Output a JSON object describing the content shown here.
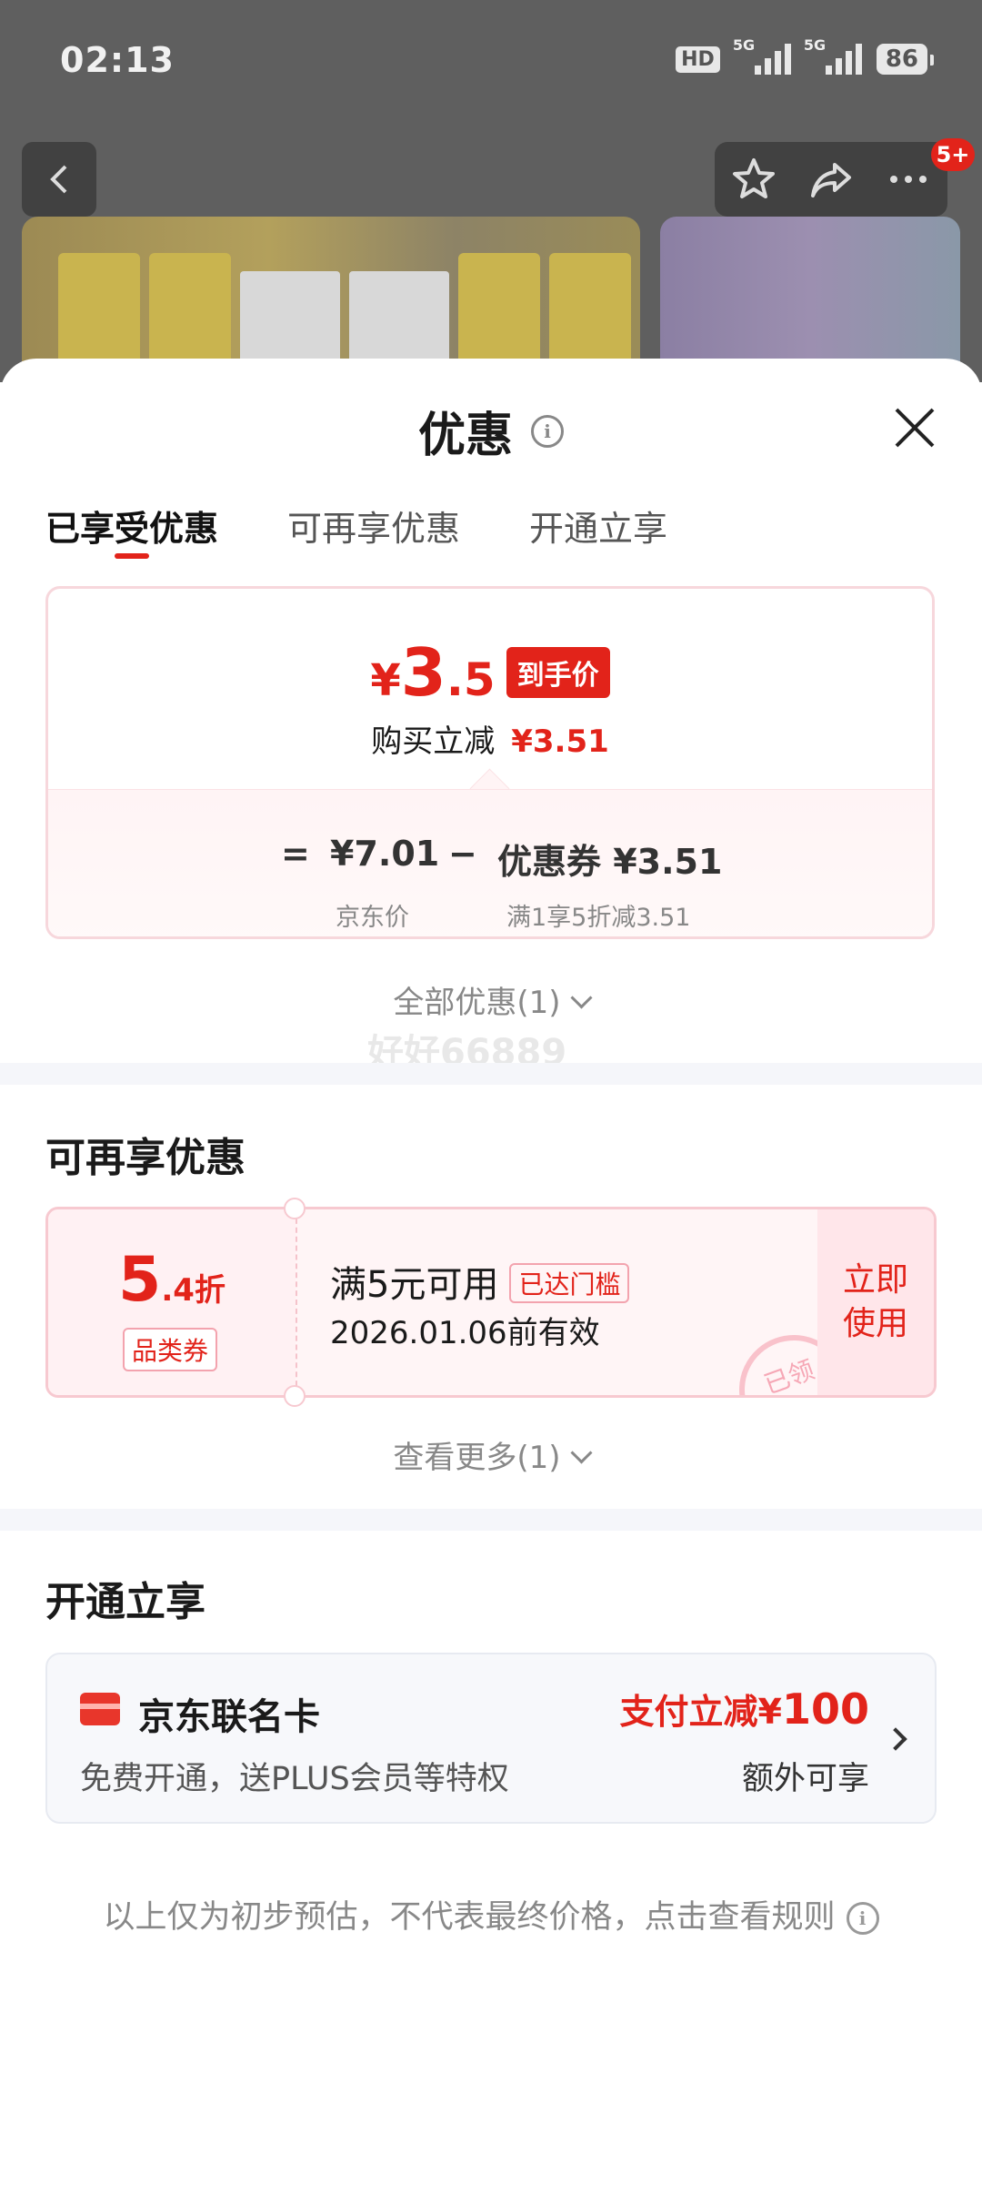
{
  "status_bar": {
    "time": "02:13",
    "hd_label": "HD",
    "signal1_label": "5G",
    "signal2_label": "5G",
    "battery": "86"
  },
  "background_page": {
    "message_badge": "5+"
  },
  "sheet": {
    "title": "优惠",
    "tabs": [
      "已享受优惠",
      "可再享优惠",
      "开通立享"
    ],
    "active_tab": "已享受优惠"
  },
  "price_card": {
    "currency": "¥",
    "price_int": "3",
    "price_dec": ".5",
    "price_tag": "到手价",
    "saving_label": "购买立减",
    "saving_value": "¥3.51",
    "equals": "=",
    "base_price": "¥7.01",
    "minus": "−",
    "coupon_part": "优惠券 ¥3.51",
    "base_price_label": "京东价",
    "coupon_part_label": "满1享5折减3.51"
  },
  "all_offers_link": "全部优惠(1)",
  "watermark": "好好66889",
  "more_offers": {
    "title": "可再享优惠",
    "coupon": {
      "value_big": "5",
      "value_small": ".4折",
      "type": "品类券",
      "condition": "满5元可用",
      "badge": "已达门槛",
      "validity": "2026.01.06前有效",
      "action_line1": "立即",
      "action_line2": "使用",
      "stamp": "已领"
    },
    "see_more_link": "查看更多(1)"
  },
  "open_offers": {
    "title": "开通立享",
    "card": {
      "name": "京东联名卡",
      "desc": "免费开通，送PLUS会员等特权",
      "promo_prefix": "支付立减¥",
      "promo_amount": "100",
      "extra": "额外可享"
    }
  },
  "disclaimer": "以上仅为初步预估，不代表最终价格，点击查看规则",
  "colors": {
    "accent_red": "#e2231a",
    "page_bg": "#ffffff",
    "section_gap": "#f5f6fa"
  },
  "icons": [
    "back-arrow-icon",
    "star-icon",
    "share-icon",
    "more-dots-icon",
    "info-icon",
    "close-icon",
    "chevron-down-icon",
    "card-icon",
    "chevron-right-icon"
  ]
}
